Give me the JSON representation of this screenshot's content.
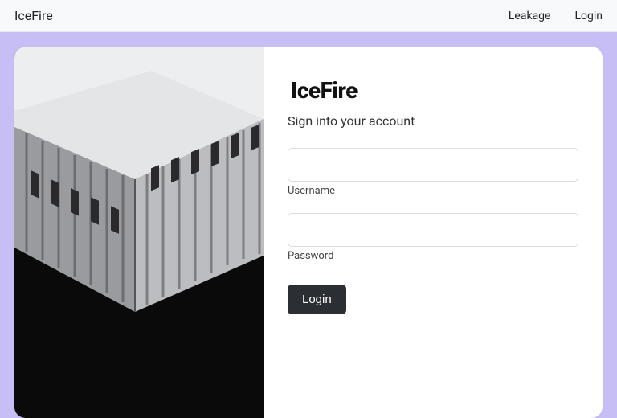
{
  "topbar": {
    "brand": "IceFire",
    "links": {
      "leakage": "Leakage",
      "login": "Login"
    }
  },
  "login": {
    "logo": "IceFire",
    "subtitle": "Sign into your account",
    "username_label": "Username",
    "username_value": "",
    "password_label": "Password",
    "password_value": "",
    "submit_label": "Login"
  },
  "colors": {
    "page_bg": "#c6bef4",
    "button_bg": "#2b2f33"
  }
}
